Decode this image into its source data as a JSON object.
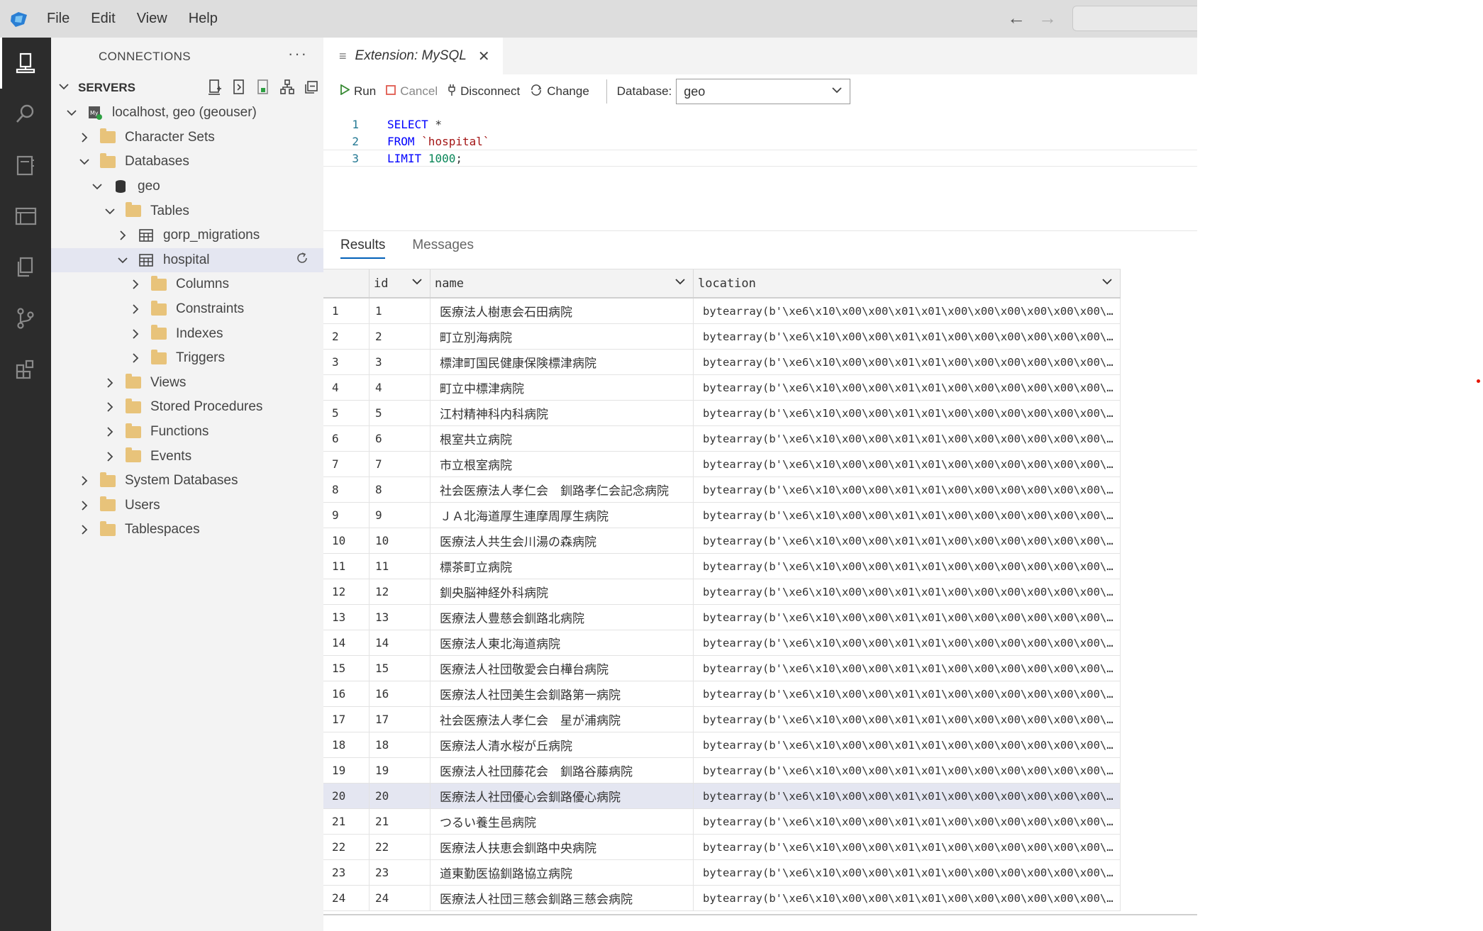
{
  "menu": [
    "File",
    "Edit",
    "View",
    "Help"
  ],
  "sidebar": {
    "header": "CONNECTIONS",
    "more": "···",
    "section": "SERVERS",
    "tree": [
      {
        "label": "localhost, geo (geouser)",
        "depth": 0,
        "expanded": true,
        "icon": "mysql-server-icon"
      },
      {
        "label": "Character Sets",
        "depth": 1,
        "expanded": false,
        "icon": "folder-icon"
      },
      {
        "label": "Databases",
        "depth": 1,
        "expanded": true,
        "icon": "folder-icon"
      },
      {
        "label": "geo",
        "depth": 2,
        "expanded": true,
        "icon": "database-icon"
      },
      {
        "label": "Tables",
        "depth": 3,
        "expanded": true,
        "icon": "folder-icon"
      },
      {
        "label": "gorp_migrations",
        "depth": 4,
        "expanded": false,
        "icon": "table-icon"
      },
      {
        "label": "hospital",
        "depth": 4,
        "expanded": true,
        "icon": "table-icon",
        "selected": true
      },
      {
        "label": "Columns",
        "depth": 5,
        "expanded": false,
        "icon": "folder-icon"
      },
      {
        "label": "Constraints",
        "depth": 5,
        "expanded": false,
        "icon": "folder-icon"
      },
      {
        "label": "Indexes",
        "depth": 5,
        "expanded": false,
        "icon": "folder-icon"
      },
      {
        "label": "Triggers",
        "depth": 5,
        "expanded": false,
        "icon": "folder-icon"
      },
      {
        "label": "Views",
        "depth": 3,
        "expanded": false,
        "icon": "folder-icon"
      },
      {
        "label": "Stored Procedures",
        "depth": 3,
        "expanded": false,
        "icon": "folder-icon"
      },
      {
        "label": "Functions",
        "depth": 3,
        "expanded": false,
        "icon": "folder-icon"
      },
      {
        "label": "Events",
        "depth": 3,
        "expanded": false,
        "icon": "folder-icon"
      },
      {
        "label": "System Databases",
        "depth": 1,
        "expanded": false,
        "icon": "folder-icon"
      },
      {
        "label": "Users",
        "depth": 1,
        "expanded": false,
        "icon": "folder-icon"
      },
      {
        "label": "Tablespaces",
        "depth": 1,
        "expanded": false,
        "icon": "folder-icon"
      }
    ]
  },
  "editor": {
    "tab_title": "Extension: MySQL",
    "toolbar": {
      "run": "Run",
      "cancel": "Cancel",
      "disconnect": "Disconnect",
      "change": "Change",
      "database_label": "Database:",
      "database_value": "geo"
    },
    "code": [
      {
        "ln": "1",
        "tokens": [
          {
            "t": "SELECT",
            "c": "kw"
          },
          {
            "t": " *",
            "c": ""
          }
        ]
      },
      {
        "ln": "2",
        "tokens": [
          {
            "t": "FROM",
            "c": "kw"
          },
          {
            "t": " ",
            "c": ""
          },
          {
            "t": "`hospital`",
            "c": "str"
          }
        ]
      },
      {
        "ln": "3",
        "tokens": [
          {
            "t": "LIMIT",
            "c": "kw"
          },
          {
            "t": " ",
            "c": ""
          },
          {
            "t": "1000",
            "c": "num"
          },
          {
            "t": ";",
            "c": ""
          }
        ]
      }
    ],
    "results_tabs": [
      "Results",
      "Messages"
    ]
  },
  "grid": {
    "columns": [
      "id",
      "name",
      "location"
    ],
    "highlighted_row": 20,
    "location_value": "bytearray(b'\\xe6\\x10\\x00\\x00\\x01\\x01\\x00\\x00\\x00\\x00\\x00\\x00\\x00\\x00\\x00",
    "rows": [
      {
        "n": "1",
        "id": "1",
        "name": "医療法人樹恵会石田病院"
      },
      {
        "n": "2",
        "id": "2",
        "name": "町立別海病院"
      },
      {
        "n": "3",
        "id": "3",
        "name": "標津町国民健康保険標津病院"
      },
      {
        "n": "4",
        "id": "4",
        "name": "町立中標津病院"
      },
      {
        "n": "5",
        "id": "5",
        "name": "江村精神科内科病院"
      },
      {
        "n": "6",
        "id": "6",
        "name": "根室共立病院"
      },
      {
        "n": "7",
        "id": "7",
        "name": "市立根室病院"
      },
      {
        "n": "8",
        "id": "8",
        "name": "社会医療法人孝仁会　釧路孝仁会記念病院"
      },
      {
        "n": "9",
        "id": "9",
        "name": "ＪＡ北海道厚生連摩周厚生病院"
      },
      {
        "n": "10",
        "id": "10",
        "name": "医療法人共生会川湯の森病院"
      },
      {
        "n": "11",
        "id": "11",
        "name": "標茶町立病院"
      },
      {
        "n": "12",
        "id": "12",
        "name": "釧央脳神経外科病院"
      },
      {
        "n": "13",
        "id": "13",
        "name": "医療法人豊慈会釧路北病院"
      },
      {
        "n": "14",
        "id": "14",
        "name": "医療法人東北海道病院"
      },
      {
        "n": "15",
        "id": "15",
        "name": "医療法人社団敬愛会白樺台病院"
      },
      {
        "n": "16",
        "id": "16",
        "name": "医療法人社団美生会釧路第一病院"
      },
      {
        "n": "17",
        "id": "17",
        "name": "社会医療法人孝仁会　星が浦病院"
      },
      {
        "n": "18",
        "id": "18",
        "name": "医療法人清水桜が丘病院"
      },
      {
        "n": "19",
        "id": "19",
        "name": "医療法人社団藤花会　釧路谷藤病院"
      },
      {
        "n": "20",
        "id": "20",
        "name": "医療法人社団優心会釧路優心病院"
      },
      {
        "n": "21",
        "id": "21",
        "name": "つるい養生邑病院"
      },
      {
        "n": "22",
        "id": "22",
        "name": "医療法人扶恵会釧路中央病院"
      },
      {
        "n": "23",
        "id": "23",
        "name": "道東勤医協釧路協立病院"
      },
      {
        "n": "24",
        "id": "24",
        "name": "医療法人社団三慈会釧路三慈会病院"
      }
    ]
  }
}
